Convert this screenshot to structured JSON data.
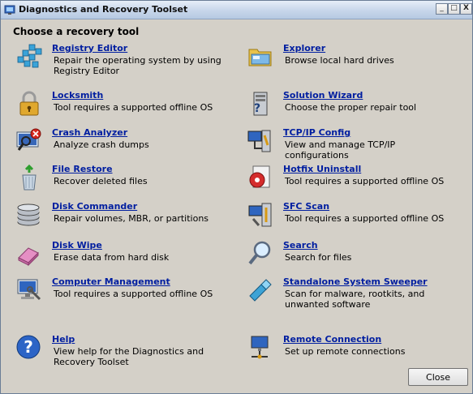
{
  "window": {
    "title": "Diagnostics and Recovery Toolset"
  },
  "heading": "Choose a recovery tool",
  "controls": {
    "minimize": "_",
    "maximize": "□",
    "close": "X"
  },
  "tools": [
    {
      "name": "Registry Editor",
      "description": "Repair the operating system by using Registry Editor",
      "icon": "registry-icon"
    },
    {
      "name": "Explorer",
      "description": "Browse local hard drives",
      "icon": "explorer-icon"
    },
    {
      "name": "Locksmith",
      "description": "Tool requires a supported offline OS",
      "icon": "lock-icon"
    },
    {
      "name": "Solution Wizard",
      "description": "Choose the proper repair tool",
      "icon": "wizard-icon"
    },
    {
      "name": "Crash Analyzer",
      "description": "Analyze crash dumps",
      "icon": "crash-analyzer-icon"
    },
    {
      "name": "TCP/IP Config",
      "description": "View and manage TCP/IP configurations",
      "icon": "network-config-icon"
    },
    {
      "name": "File Restore",
      "description": "Recover deleted files",
      "icon": "recycle-bin-icon"
    },
    {
      "name": "Hotfix Uninstall",
      "description": "Tool requires a supported offline OS",
      "icon": "hotfix-icon"
    },
    {
      "name": "Disk Commander",
      "description": "Repair volumes, MBR, or partitions",
      "icon": "disk-icon"
    },
    {
      "name": "SFC Scan",
      "description": "Tool requires a supported offline OS",
      "icon": "sfc-icon"
    },
    {
      "name": "Disk Wipe",
      "description": "Erase data from hard disk",
      "icon": "eraser-icon"
    },
    {
      "name": "Search",
      "description": "Search for files",
      "icon": "magnifier-icon"
    },
    {
      "name": "Computer Management",
      "description": "Tool requires a supported offline OS",
      "icon": "computer-management-icon"
    },
    {
      "name": "Standalone System Sweeper",
      "description": "Scan for malware, rootkits, and unwanted software",
      "icon": "flashlight-icon"
    },
    {
      "name": "Help",
      "description": "View help for the Diagnostics and Recovery Toolset",
      "icon": "help-icon"
    },
    {
      "name": "Remote Connection",
      "description": "Set up remote connections",
      "icon": "remote-connection-icon"
    }
  ],
  "close_button": "Close"
}
